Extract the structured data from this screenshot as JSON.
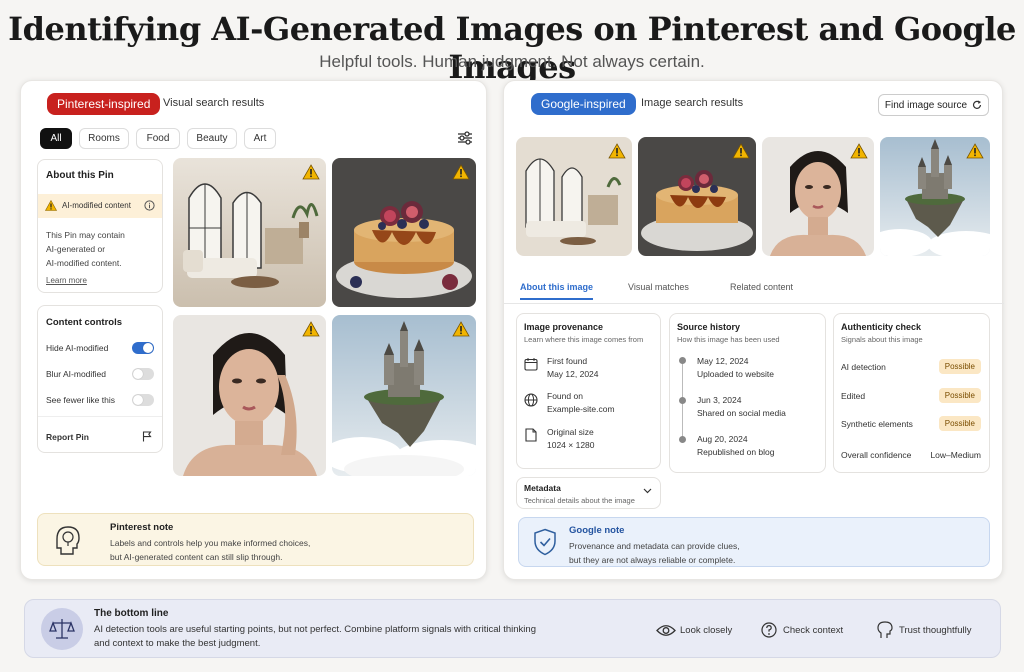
{
  "header": {
    "title": "Identifying AI-Generated Images on Pinterest and Google Images",
    "subtitle": "Helpful tools. Human judgment. Not always certain."
  },
  "pinterest": {
    "badge": "Pinterest-inspired",
    "header_label": "Visual search results",
    "chips": [
      "All",
      "Rooms",
      "Food",
      "Beauty",
      "Art"
    ],
    "about": {
      "title": "About this Pin",
      "ai_label": "AI-modified content",
      "desc_lines": [
        "This Pin may contain",
        "AI-generated or",
        "AI-modified content."
      ],
      "learn_more": "Learn more"
    },
    "controls": {
      "title": "Content controls",
      "items": [
        {
          "label": "Hide AI-modified",
          "on": true
        },
        {
          "label": "Blur AI-modified",
          "on": false
        },
        {
          "label": "See fewer like this",
          "on": false
        }
      ],
      "report": "Report Pin"
    },
    "note": {
      "title": "Pinterest note",
      "lines": [
        "Labels and controls help you make informed choices,",
        "but AI-generated content can still slip through."
      ]
    }
  },
  "google": {
    "badge": "Google-inspired",
    "header_label": "Image search results",
    "find_source": "Find image source",
    "tabs": [
      "About this image",
      "Visual matches",
      "Related content"
    ],
    "provenance": {
      "title": "Image provenance",
      "subtitle": "Learn where this image comes from",
      "items": [
        {
          "label": "First found",
          "value": "May 12, 2024"
        },
        {
          "label": "Found on",
          "value": "Example-site.com"
        },
        {
          "label": "Original size",
          "value": "1024 × 1280"
        }
      ]
    },
    "history": {
      "title": "Source history",
      "subtitle": "How this image has been used",
      "items": [
        {
          "date": "May 12, 2024",
          "event": "Uploaded to website"
        },
        {
          "date": "Jun 3, 2024",
          "event": "Shared on social media"
        },
        {
          "date": "Aug 20, 2024",
          "event": "Republished on blog"
        }
      ]
    },
    "authenticity": {
      "title": "Authenticity check",
      "subtitle": "Signals about this image",
      "items": [
        {
          "label": "AI detection",
          "value": "Possible"
        },
        {
          "label": "Edited",
          "value": "Possible"
        },
        {
          "label": "Synthetic elements",
          "value": "Possible"
        }
      ],
      "confidence_label": "Overall confidence",
      "confidence_value": "Low–Medium"
    },
    "metadata": {
      "title": "Metadata",
      "subtitle": "Technical details about the image"
    },
    "note": {
      "title": "Google note",
      "lines": [
        "Provenance and metadata can provide clues,",
        "but they are not always reliable or complete."
      ]
    }
  },
  "bottom": {
    "title": "The bottom line",
    "lines": [
      "AI detection tools are useful starting points, but not perfect. Combine platform signals with critical thinking",
      "and context to make the best judgment."
    ],
    "actions": [
      "Look closely",
      "Check context",
      "Trust thoughtfully"
    ]
  },
  "colors": {
    "pinterest_red": "#c8211e",
    "google_blue": "#2f6dcc",
    "warning_yellow": "#f2b500"
  }
}
